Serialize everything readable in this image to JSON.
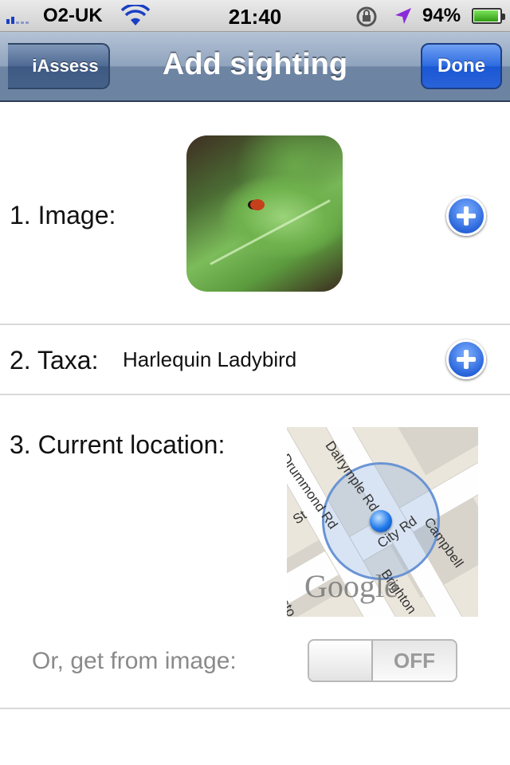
{
  "status_bar": {
    "carrier": "O2-UK",
    "time": "21:40",
    "battery_percent": "94%",
    "battery_level": 0.94,
    "icons": [
      "signal-icon",
      "wifi-icon",
      "rotation-lock-icon",
      "location-arrow-icon",
      "battery-icon"
    ]
  },
  "nav": {
    "back_label": "iAssess",
    "title": "Add sighting",
    "done_label": "Done"
  },
  "form": {
    "image": {
      "label": "1. Image:",
      "thumbnail": "ladybird-on-leaf-photo"
    },
    "taxa": {
      "label": "2. Taxa:",
      "value": "Harlequin Ladybird"
    },
    "location": {
      "label": "3. Current location:",
      "map": {
        "provider_logo": "Google",
        "street_labels": [
          "Dalrymple Rd",
          "Drummond Rd",
          "City Rd",
          "Campbell",
          "St",
          "Brighton",
          "sto"
        ]
      },
      "from_image_label": "Or, get from image:",
      "from_image_toggle": "OFF"
    }
  },
  "colors": {
    "nav_bar": "#8fa3bd",
    "done_button": "#2c6ae0",
    "add_button": "#2a66dc"
  }
}
